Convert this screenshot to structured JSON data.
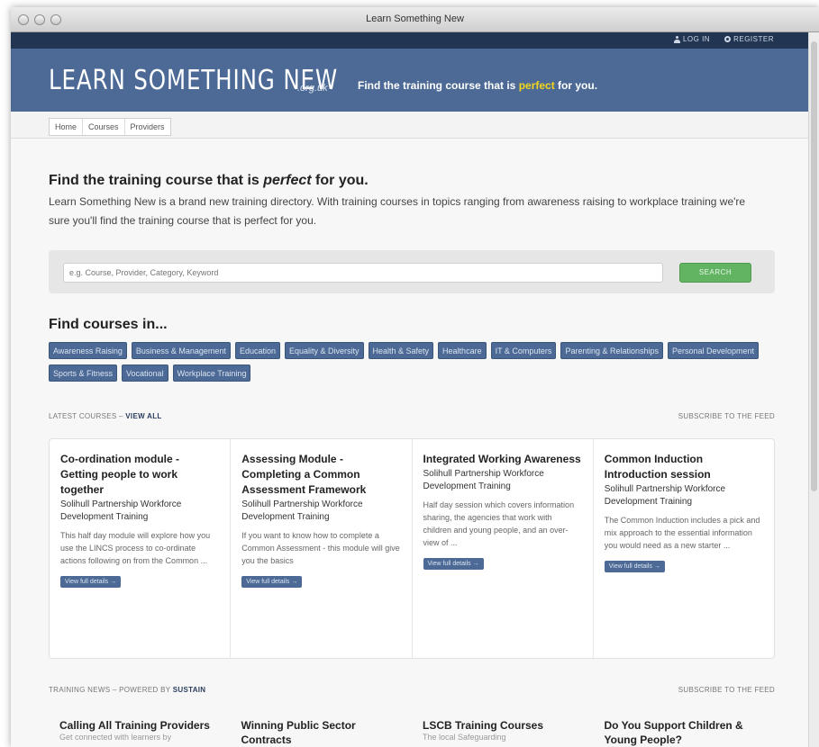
{
  "window": {
    "title": "Learn Something New"
  },
  "account": {
    "login_label": "LOG IN",
    "register_label": "REGISTER"
  },
  "header": {
    "logo_text": "LEARN SOMETHING NEW",
    "logo_suffix": ".org.uk",
    "tagline_before": "Find the training course that is ",
    "tagline_highlight": "perfect",
    "tagline_after": " for you."
  },
  "nav": {
    "items": [
      "Home",
      "Courses",
      "Providers"
    ]
  },
  "hero": {
    "heading_before": "Find the training course that is ",
    "heading_em": "perfect",
    "heading_after": " for you.",
    "body": "Learn Something New is a brand new training directory. With training courses in topics ranging from awareness raising to workplace training we're sure you'll find the training course that is perfect for you."
  },
  "search": {
    "placeholder": "e.g. Course, Provider, Category, Keyword",
    "button_label": "SEARCH"
  },
  "categories": {
    "heading": "Find courses in...",
    "items": [
      "Awareness Raising",
      "Business & Management",
      "Education",
      "Equality & Diversity",
      "Health & Safety",
      "Healthcare",
      "IT & Computers",
      "Parenting & Relationships",
      "Personal Development",
      "Sports & Fitness",
      "Vocational",
      "Workplace Training"
    ]
  },
  "latest": {
    "label": "LATEST COURSES – ",
    "view_all": "VIEW ALL",
    "subscribe": "SUBSCRIBE TO THE FEED",
    "cards": [
      {
        "title": "Co-ordination module - Getting people to work together",
        "provider": "Solihull Partnership Workforce Development Training",
        "summary": "This half day module will explore how you use the LINCS process to co-ordinate actions following on from the Common ...",
        "button": "View full details →"
      },
      {
        "title": "Assessing Module - Completing a Common Assessment Framework",
        "provider": "Solihull Partnership Workforce Development Training",
        "summary": "If you want to know how to complete a Common Assessment - this module will give you the basics",
        "button": "View full details →"
      },
      {
        "title": "Integrated Working Awareness",
        "provider": "Solihull Partnership Workforce Development Training",
        "summary": "Half day session which covers information sharing, the agencies that work with children and young people, and an over-view of ...",
        "button": "View full details →"
      },
      {
        "title": "Common Induction Introduction session",
        "provider": "Solihull Partnership Workforce Development Training",
        "summary": "The Common Induction includes a pick and mix approach to the essential information you would need as a new starter ...",
        "button": "View full details →"
      }
    ]
  },
  "news": {
    "label": "TRAINING NEWS – POWERED BY ",
    "brand": "SUSTAIN",
    "subscribe": "SUBSCRIBE TO THE FEED",
    "items": [
      {
        "title": "Calling All Training Providers",
        "sub": "Get connected with learners by"
      },
      {
        "title": "Winning Public Sector Contracts",
        "sub": ""
      },
      {
        "title": "LSCB Training Courses",
        "sub": "The local Safeguarding"
      },
      {
        "title": "Do You Support Children & Young People?",
        "sub": ""
      }
    ]
  },
  "colors": {
    "brand_blue": "#4c6a95",
    "dark_bar": "#223654",
    "highlight": "#f2d61c",
    "search_green": "#62b463"
  }
}
